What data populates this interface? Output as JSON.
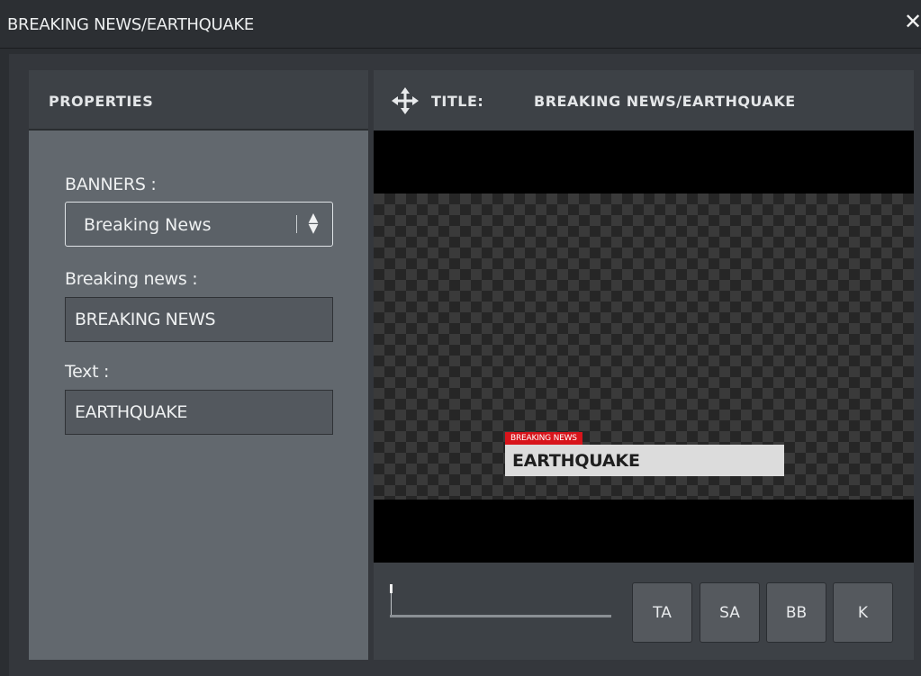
{
  "window": {
    "title": "BREAKING NEWS/EARTHQUAKE",
    "close_glyph": "✕"
  },
  "properties": {
    "header": "PROPERTIES",
    "banners_label": "BANNERS :",
    "banners_value": "Breaking News",
    "breaking_news_label": "Breaking news :",
    "breaking_news_value": "BREAKING NEWS",
    "text_label": "Text :",
    "text_value": "EARTHQUAKE"
  },
  "preview": {
    "icon": "move-icon",
    "title_label": "TITLE:",
    "title_value": "BREAKING NEWS/EARTHQUAKE",
    "lower_third": {
      "tag": "BREAKING NEWS",
      "headline": "EARTHQUAKE"
    }
  },
  "controls": {
    "buttons": [
      "TA",
      "SA",
      "BB",
      "K"
    ]
  },
  "colors": {
    "accent_red": "#d8141b",
    "panel_bg": "#62686e",
    "header_bg": "#3d4146"
  }
}
